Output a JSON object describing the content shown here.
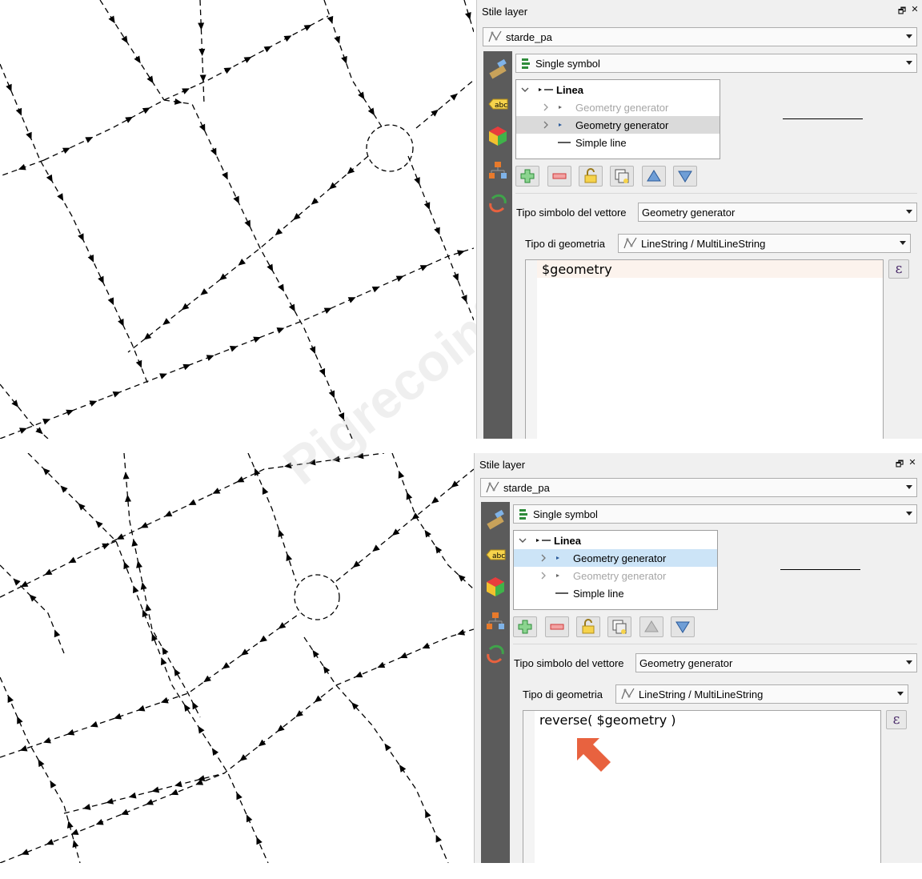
{
  "panels": [
    {
      "title": "Stile layer",
      "float_glyph": "🗗",
      "close_glyph": "✕",
      "layer_name": "starde_pa",
      "renderer": "Single symbol",
      "tree": {
        "root": "Linea",
        "items": [
          "Geometry generator",
          "Geometry generator",
          "Simple line"
        ]
      },
      "symbol_type_label": "Tipo simbolo del vettore",
      "symbol_type_value": "Geometry generator",
      "geometry_type_label": "Tipo di geometria",
      "geometry_type_value": "LineString / MultiLineString",
      "expression": "$geometry",
      "expr_button": "ε"
    },
    {
      "title": "Stile layer",
      "float_glyph": "🗗",
      "close_glyph": "✕",
      "layer_name": "starde_pa",
      "renderer": "Single symbol",
      "tree": {
        "root": "Linea",
        "items": [
          "Geometry generator",
          "Geometry generator",
          "Simple line"
        ]
      },
      "symbol_type_label": "Tipo simbolo del vettore",
      "symbol_type_value": "Geometry generator",
      "geometry_type_label": "Tipo di geometria",
      "geometry_type_value": "LineString / MultiLineString",
      "expression": "reverse( $geometry )",
      "expr_button": "ε"
    }
  ],
  "sidebar_icons": [
    "paint-brush-icon",
    "label-abc-icon",
    "3d-cube-icon",
    "hierarchy-icon",
    "history-undo-icon"
  ],
  "toolbar_icons": [
    "add-symbol-layer-icon",
    "remove-symbol-layer-icon",
    "lock-icon",
    "duplicate-icon",
    "move-up-icon",
    "move-down-icon"
  ],
  "annotation_arrow_color": "#e8623f",
  "watermark": "Pigrecoinfinito"
}
